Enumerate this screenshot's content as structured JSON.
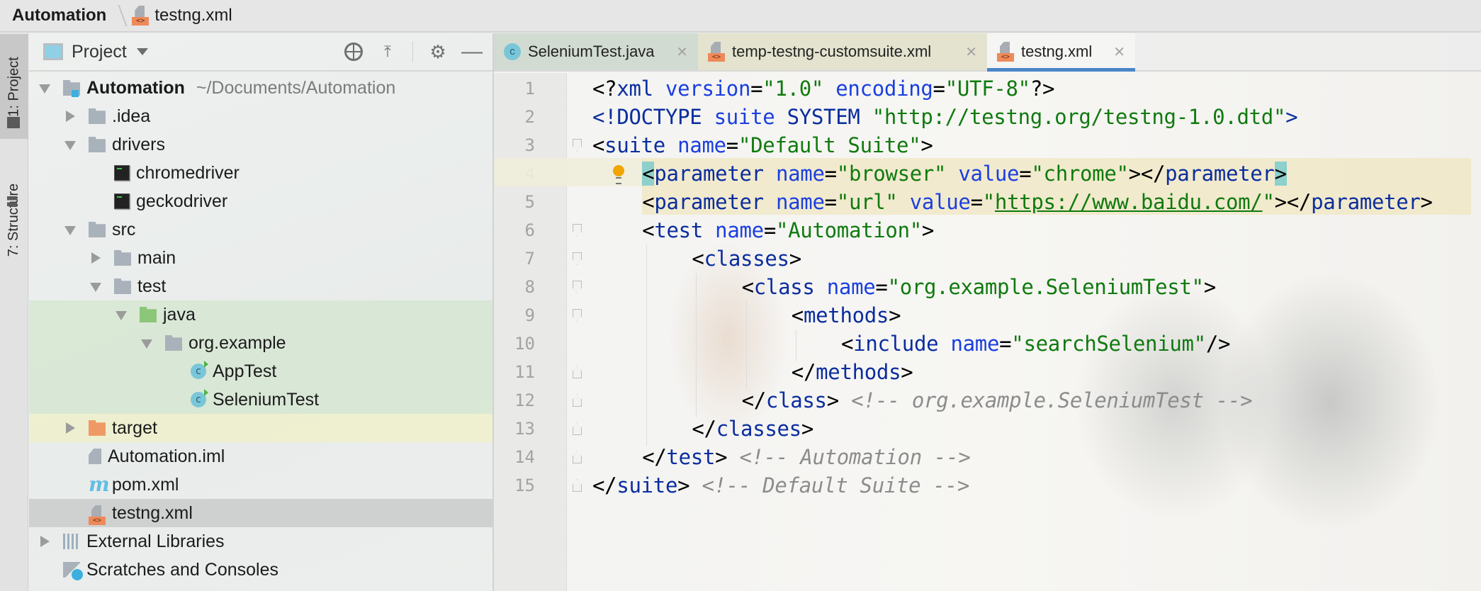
{
  "breadcrumb": {
    "project": "Automation",
    "file": "testng.xml"
  },
  "tool_stripe": {
    "project_tab": "1: Project",
    "structure_tab": "7: Structure"
  },
  "project_panel": {
    "title": "Project",
    "tree": [
      {
        "label": "Automation",
        "suffix": "~/Documents/Automation",
        "level": 0,
        "arrow": "down",
        "icon": "module",
        "bold": true
      },
      {
        "label": ".idea",
        "level": 1,
        "arrow": "right",
        "icon": "folder"
      },
      {
        "label": "drivers",
        "level": 1,
        "arrow": "down",
        "icon": "folder"
      },
      {
        "label": "chromedriver",
        "level": 2,
        "arrow": "",
        "icon": "exe"
      },
      {
        "label": "geckodriver",
        "level": 2,
        "arrow": "",
        "icon": "exe"
      },
      {
        "label": "src",
        "level": 1,
        "arrow": "down",
        "icon": "folder"
      },
      {
        "label": "main",
        "level": 2,
        "arrow": "right",
        "icon": "folder"
      },
      {
        "label": "test",
        "level": 2,
        "arrow": "down",
        "icon": "folder"
      },
      {
        "label": "java",
        "level": 3,
        "arrow": "down",
        "icon": "folder-green",
        "highlight": "green"
      },
      {
        "label": "org.example",
        "level": 4,
        "arrow": "down",
        "icon": "package",
        "highlight": "green"
      },
      {
        "label": "AppTest",
        "level": 5,
        "arrow": "",
        "icon": "class",
        "highlight": "green"
      },
      {
        "label": "SeleniumTest",
        "level": 5,
        "arrow": "",
        "icon": "class",
        "highlight": "green"
      },
      {
        "label": "target",
        "level": 1,
        "arrow": "right",
        "icon": "folder-orange",
        "highlight": "yellow"
      },
      {
        "label": "Automation.iml",
        "level": 1,
        "arrow": "",
        "icon": "iml"
      },
      {
        "label": "pom.xml",
        "level": 1,
        "arrow": "",
        "icon": "maven"
      },
      {
        "label": "testng.xml",
        "level": 1,
        "arrow": "",
        "icon": "xml",
        "highlight": "sel"
      },
      {
        "label": "External Libraries",
        "level": 0,
        "arrow": "right",
        "icon": "libraries"
      },
      {
        "label": "Scratches and Consoles",
        "level": 0,
        "arrow": "",
        "icon": "scratches"
      }
    ]
  },
  "editor": {
    "tabs": [
      {
        "label": "SeleniumTest.java",
        "icon": "java-class"
      },
      {
        "label": "temp-testng-customsuite.xml",
        "icon": "xml"
      },
      {
        "label": "testng.xml",
        "icon": "xml",
        "active": true
      }
    ],
    "current_line": 4,
    "lines": [
      {
        "n": "1",
        "indent": 0,
        "fold": "",
        "tokens": [
          [
            "p",
            "<?"
          ],
          [
            "t",
            "xml"
          ],
          [
            "p",
            " "
          ],
          [
            "a",
            "version"
          ],
          [
            "p",
            "="
          ],
          [
            "s",
            "\"1.0\""
          ],
          [
            "p",
            " "
          ],
          [
            "a",
            "encoding"
          ],
          [
            "p",
            "="
          ],
          [
            "s",
            "\"UTF-8\""
          ],
          [
            "p",
            "?>"
          ]
        ]
      },
      {
        "n": "2",
        "indent": 0,
        "fold": "",
        "tokens": [
          [
            "t",
            "<!DOCTYPE "
          ],
          [
            "a",
            "suite "
          ],
          [
            "t",
            "SYSTEM "
          ],
          [
            "s",
            "\"http://testng.org/testng-1.0.dtd\""
          ],
          [
            "t",
            ">"
          ]
        ]
      },
      {
        "n": "3",
        "indent": 0,
        "fold": "open",
        "tokens": [
          [
            "p",
            "<"
          ],
          [
            "t",
            "suite"
          ],
          [
            "p",
            " "
          ],
          [
            "a",
            "name"
          ],
          [
            "p",
            "="
          ],
          [
            "s",
            "\"Default Suite\""
          ],
          [
            "p",
            ">"
          ]
        ]
      },
      {
        "n": "4",
        "indent": 4,
        "fold": "",
        "tokens": [
          [
            "b",
            "<"
          ],
          [
            "t",
            "parameter"
          ],
          [
            "p",
            " "
          ],
          [
            "a",
            "name"
          ],
          [
            "p",
            "="
          ],
          [
            "s",
            "\"browser\""
          ],
          [
            "p",
            " "
          ],
          [
            "a",
            "value"
          ],
          [
            "p",
            "="
          ],
          [
            "s",
            "\"chrome\""
          ],
          [
            "p",
            "></"
          ],
          [
            "t",
            "parameter"
          ],
          [
            "b",
            ">"
          ]
        ]
      },
      {
        "n": "5",
        "indent": 4,
        "fold": "",
        "tokens": [
          [
            "p",
            "<"
          ],
          [
            "t",
            "parameter"
          ],
          [
            "p",
            " "
          ],
          [
            "a",
            "name"
          ],
          [
            "p",
            "="
          ],
          [
            "s",
            "\"url\""
          ],
          [
            "p",
            " "
          ],
          [
            "a",
            "value"
          ],
          [
            "p",
            "="
          ],
          [
            "s",
            "\""
          ],
          [
            "u",
            "https://www.baidu.com/"
          ],
          [
            "s",
            "\""
          ],
          [
            "p",
            "></"
          ],
          [
            "t",
            "parameter"
          ],
          [
            "p",
            ">"
          ]
        ]
      },
      {
        "n": "6",
        "indent": 4,
        "fold": "open",
        "tokens": [
          [
            "p",
            "<"
          ],
          [
            "t",
            "test"
          ],
          [
            "p",
            " "
          ],
          [
            "a",
            "name"
          ],
          [
            "p",
            "="
          ],
          [
            "s",
            "\"Automation\""
          ],
          [
            "p",
            ">"
          ]
        ]
      },
      {
        "n": "7",
        "indent": 8,
        "fold": "open",
        "tokens": [
          [
            "p",
            "<"
          ],
          [
            "t",
            "classes"
          ],
          [
            "p",
            ">"
          ]
        ]
      },
      {
        "n": "8",
        "indent": 12,
        "fold": "open",
        "tokens": [
          [
            "p",
            "<"
          ],
          [
            "t",
            "class"
          ],
          [
            "p",
            " "
          ],
          [
            "a",
            "name"
          ],
          [
            "p",
            "="
          ],
          [
            "s",
            "\"org.example.SeleniumTest\""
          ],
          [
            "p",
            ">"
          ]
        ]
      },
      {
        "n": "9",
        "indent": 16,
        "fold": "open",
        "tokens": [
          [
            "p",
            "<"
          ],
          [
            "t",
            "methods"
          ],
          [
            "p",
            ">"
          ]
        ]
      },
      {
        "n": "10",
        "indent": 20,
        "fold": "",
        "tokens": [
          [
            "p",
            "<"
          ],
          [
            "t",
            "include"
          ],
          [
            "p",
            " "
          ],
          [
            "a",
            "name"
          ],
          [
            "p",
            "="
          ],
          [
            "s",
            "\"searchSelenium\""
          ],
          [
            "p",
            "/>"
          ]
        ]
      },
      {
        "n": "11",
        "indent": 16,
        "fold": "close",
        "tokens": [
          [
            "p",
            "</"
          ],
          [
            "t",
            "methods"
          ],
          [
            "p",
            ">"
          ]
        ]
      },
      {
        "n": "12",
        "indent": 12,
        "fold": "close",
        "tokens": [
          [
            "p",
            "</"
          ],
          [
            "t",
            "class"
          ],
          [
            "p",
            "> "
          ],
          [
            "c",
            "<!-- org.example.SeleniumTest -->"
          ]
        ]
      },
      {
        "n": "13",
        "indent": 8,
        "fold": "close",
        "tokens": [
          [
            "p",
            "</"
          ],
          [
            "t",
            "classes"
          ],
          [
            "p",
            ">"
          ]
        ]
      },
      {
        "n": "14",
        "indent": 4,
        "fold": "close",
        "tokens": [
          [
            "p",
            "</"
          ],
          [
            "t",
            "test"
          ],
          [
            "p",
            "> "
          ],
          [
            "c",
            "<!-- Automation -->"
          ]
        ]
      },
      {
        "n": "15",
        "indent": 0,
        "fold": "close",
        "tokens": [
          [
            "p",
            "</"
          ],
          [
            "t",
            "suite"
          ],
          [
            "p",
            "> "
          ],
          [
            "c",
            "<!-- Default Suite -->"
          ]
        ]
      }
    ]
  }
}
